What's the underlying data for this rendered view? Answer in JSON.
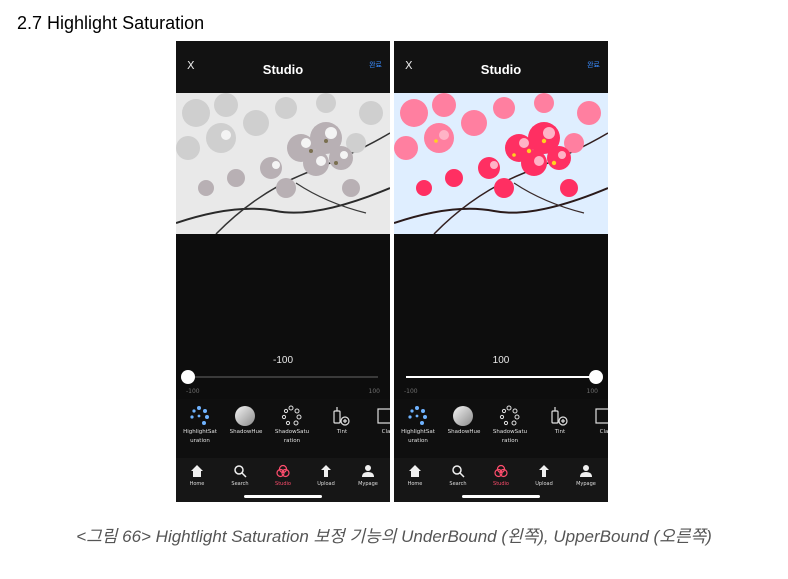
{
  "section_title": "2.7 Highlight Saturation",
  "phones": {
    "left": {
      "close_label": "X",
      "title": "Studio",
      "done_label": "완료",
      "value": "-100",
      "slider_level": -100,
      "range_min": "-100",
      "range_max": "100",
      "tools": [
        "HighlightSat\nuration",
        "ShadowHue",
        "ShadowSatu\nration",
        "Tint",
        "Cla"
      ],
      "tabs": [
        "Home",
        "Search",
        "Studio",
        "Upload",
        "Mypage"
      ],
      "photo_mode": "grayscale"
    },
    "right": {
      "close_label": "X",
      "title": "Studio",
      "done_label": "완료",
      "value": "100",
      "slider_level": 100,
      "range_min": "-100",
      "range_max": "100",
      "tools": [
        "HighlightSat\nuration",
        "ShadowHue",
        "ShadowSatu\nration",
        "Tint",
        "Cla"
      ],
      "tabs": [
        "Home",
        "Search",
        "Studio",
        "Upload",
        "Mypage"
      ],
      "photo_mode": "saturated"
    }
  },
  "colors": {
    "accent_blue": "#3a8dff",
    "active_tab": "#ff4d6d",
    "blossom_saturated": "#ff2f62",
    "blossom_gray": "#d9d9d9"
  },
  "caption": "<그림 66> Hightlight Saturation 보정 기능의 UnderBound (왼쪽), UpperBound (오른쪽)"
}
